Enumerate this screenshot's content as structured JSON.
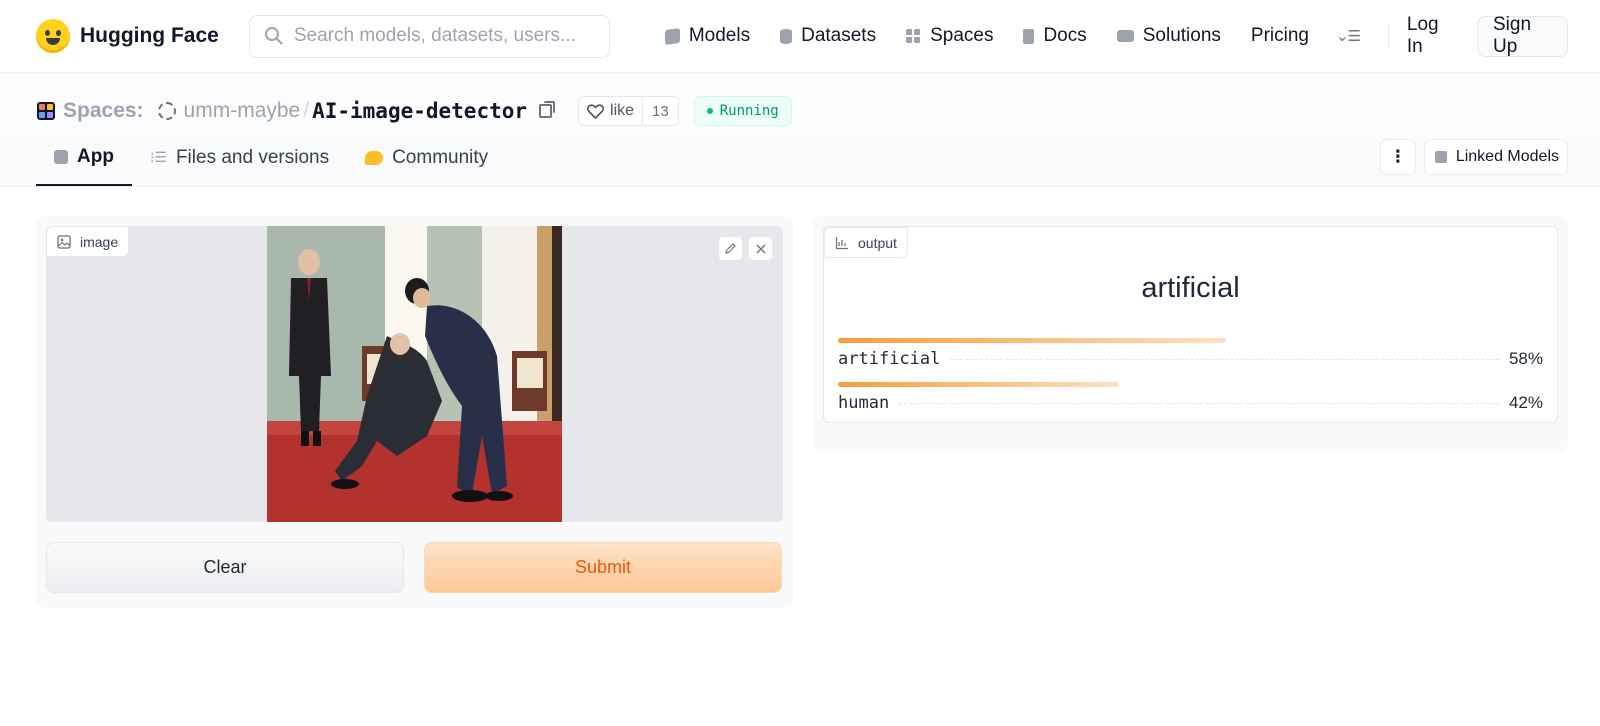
{
  "nav": {
    "brand": "Hugging Face",
    "search_placeholder": "Search models, datasets, users...",
    "links": [
      "Models",
      "Datasets",
      "Spaces",
      "Docs",
      "Solutions",
      "Pricing"
    ],
    "login": "Log In",
    "signup": "Sign Up"
  },
  "header": {
    "spaces_label": "Spaces:",
    "owner": "umm-maybe",
    "separator": "/",
    "repo": "AI-image-detector",
    "like_label": "like",
    "like_count": "13",
    "status": "Running",
    "tabs": [
      "App",
      "Files and versions",
      "Community"
    ],
    "linked_models": "Linked Models"
  },
  "input": {
    "label": "image",
    "clear": "Clear",
    "submit": "Submit"
  },
  "output": {
    "label": "output",
    "top_label": "artificial",
    "confidences": [
      {
        "label": "artificial",
        "value": 0.58,
        "text": "58%"
      },
      {
        "label": "human",
        "value": 0.42,
        "text": "42%"
      }
    ]
  },
  "colors": {
    "accent_orange": "#ea580c",
    "status_green": "#059669",
    "bar_orange": "#f59e3a"
  }
}
